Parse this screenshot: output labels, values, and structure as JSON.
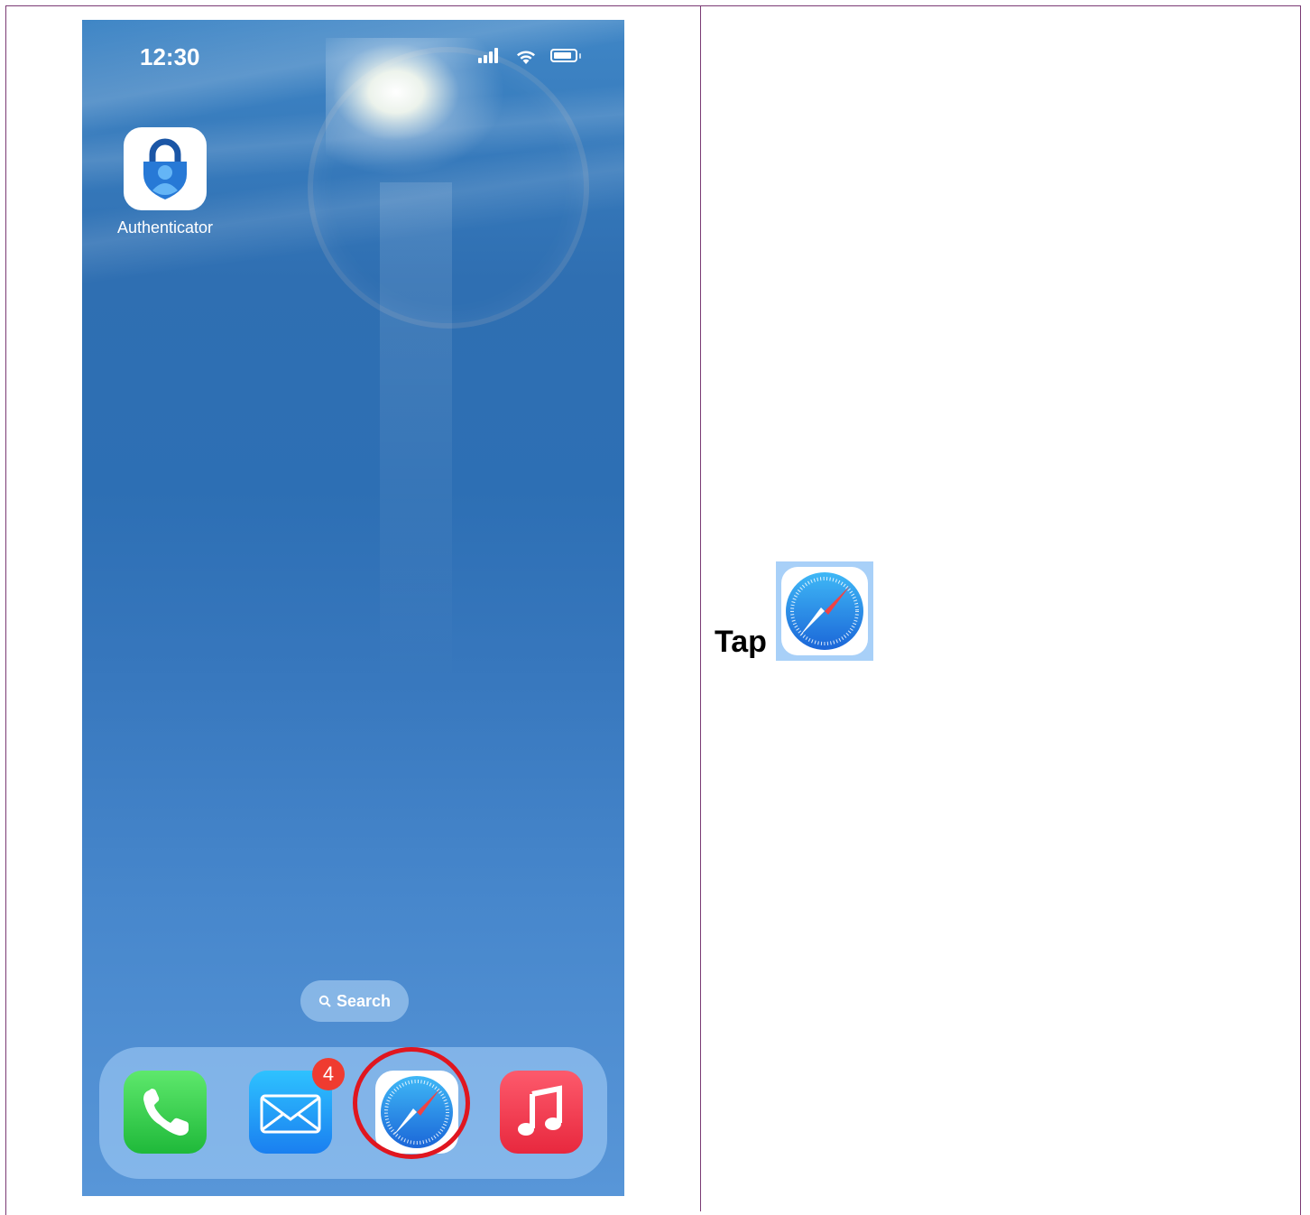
{
  "phone": {
    "status_time": "12:30",
    "apps": {
      "authenticator_label": "Authenticator"
    },
    "search_label": "Search",
    "dock": {
      "mail_badge": "4"
    }
  },
  "instruction": {
    "verb": "Tap"
  },
  "colors": {
    "border": "#7b3a74",
    "highlight_ring": "#e0161f",
    "badge": "#ef3b30"
  }
}
